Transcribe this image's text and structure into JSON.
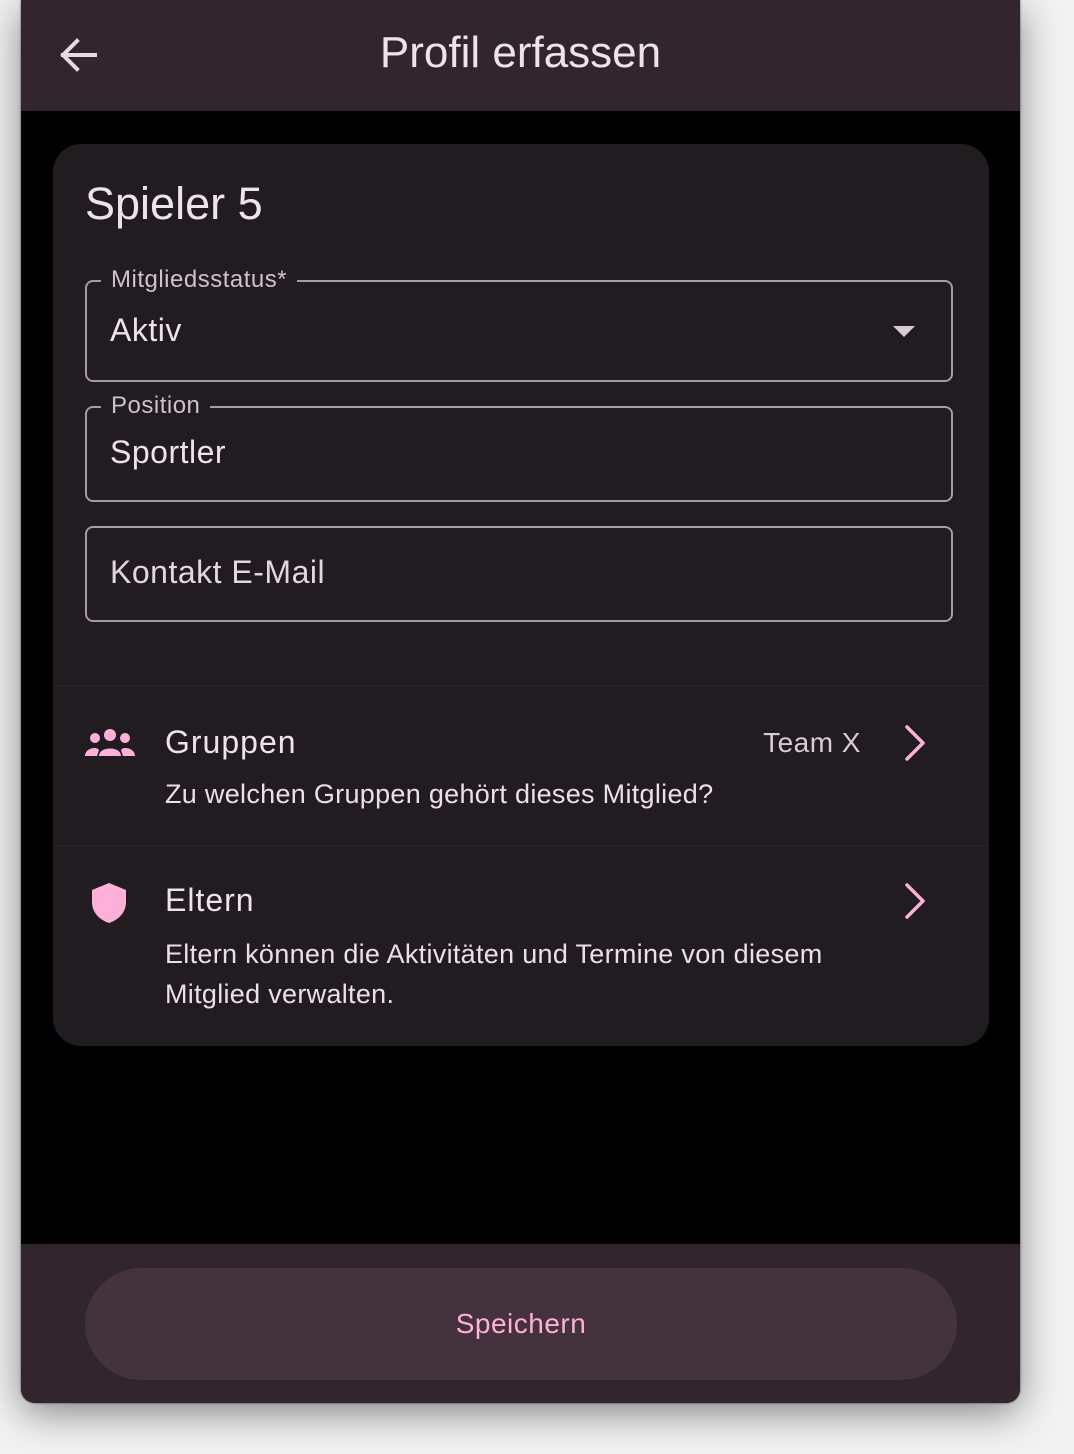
{
  "appbar": {
    "title": "Profil erfassen",
    "back_icon": "arrow-back-icon"
  },
  "card": {
    "title": "Spieler 5",
    "membership_status": {
      "label": "Mitgliedsstatus*",
      "value": "Aktiv"
    },
    "position": {
      "label": "Position",
      "value": "Sportler"
    },
    "contact_email": {
      "placeholder": "Kontakt E-Mail"
    },
    "groups": {
      "icon": "groups-icon",
      "title": "Gruppen",
      "subtitle": "Zu welchen Gruppen gehört dieses Mitglied?",
      "trailing": "Team X"
    },
    "parents": {
      "icon": "shield-icon",
      "title": "Eltern",
      "subtitle": "Eltern können die Aktivitäten und Termine von diesem Mitglied verwalten."
    }
  },
  "bottom": {
    "save_label": "Speichern"
  },
  "colors": {
    "accent": "#ffb0d8",
    "surface": "#211c1f",
    "appbar": "#31262e",
    "background": "#000000"
  }
}
